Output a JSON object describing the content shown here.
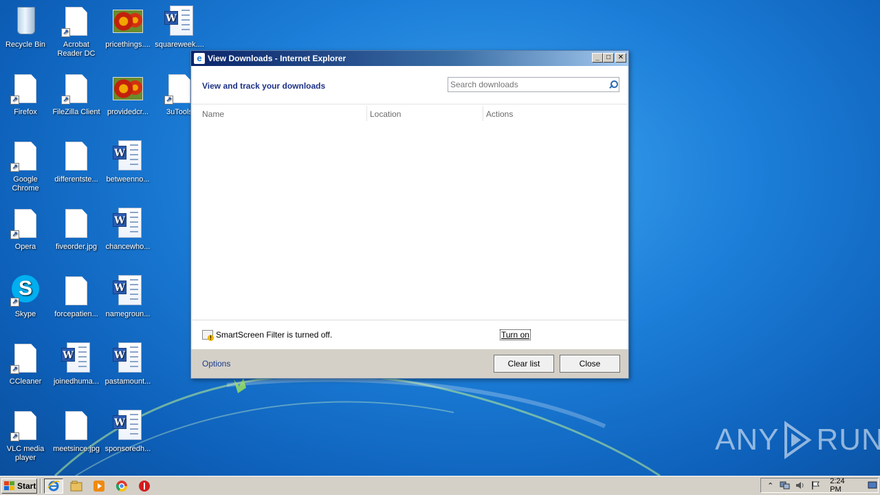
{
  "desktop": {
    "icons": [
      {
        "label": "Recycle Bin",
        "icon": "recycle-bin-icon"
      },
      {
        "label": "Acrobat Reader DC",
        "icon": "acrobat-shortcut-icon"
      },
      {
        "label": "pricethings....",
        "icon": "image-file-icon"
      },
      {
        "label": "squareweek....",
        "icon": "word-document-icon"
      },
      {
        "label": "Firefox",
        "icon": "firefox-shortcut-icon"
      },
      {
        "label": "FileZilla Client",
        "icon": "filezilla-shortcut-icon"
      },
      {
        "label": "providedcr...",
        "icon": "image-file-icon"
      },
      {
        "label": "3uTools",
        "icon": "3utools-shortcut-icon"
      },
      {
        "label": "Google Chrome",
        "icon": "chrome-shortcut-icon"
      },
      {
        "label": "differentste...",
        "icon": "file-icon"
      },
      {
        "label": "betweenno...",
        "icon": "word-document-icon"
      },
      {
        "label": "Opera",
        "icon": "opera-shortcut-icon"
      },
      {
        "label": "fiveorder.jpg",
        "icon": "file-icon"
      },
      {
        "label": "chancewho...",
        "icon": "word-document-icon"
      },
      {
        "label": "Skype",
        "icon": "skype-shortcut-icon"
      },
      {
        "label": "forcepatien...",
        "icon": "file-icon"
      },
      {
        "label": "namegroun...",
        "icon": "word-document-icon"
      },
      {
        "label": "CCleaner",
        "icon": "ccleaner-shortcut-icon"
      },
      {
        "label": "joinedhuma...",
        "icon": "word-document-icon"
      },
      {
        "label": "pastamount...",
        "icon": "word-document-icon"
      },
      {
        "label": "VLC media player",
        "icon": "vlc-shortcut-icon"
      },
      {
        "label": "meetsince.jpg",
        "icon": "file-icon"
      },
      {
        "label": "sponsoredh...",
        "icon": "word-document-icon"
      }
    ]
  },
  "dialog": {
    "title": "View Downloads - Internet Explorer",
    "heading": "View and track your downloads",
    "search_placeholder": "Search downloads",
    "columns": [
      "Name",
      "Location",
      "Actions"
    ],
    "smartscreen_text": "SmartScreen Filter is turned off.",
    "turn_on_label": "Turn on",
    "options_label": "Options",
    "clear_list_label": "Clear list",
    "close_label": "Close"
  },
  "watermark": {
    "left": "ANY",
    "right": "RUN"
  },
  "taskbar": {
    "start_label": "Start",
    "clock": "2:24 PM",
    "pinned": [
      "internet-explorer-icon",
      "explorer-folder-icon",
      "media-player-icon",
      "chrome-icon",
      "stop-icon"
    ]
  }
}
